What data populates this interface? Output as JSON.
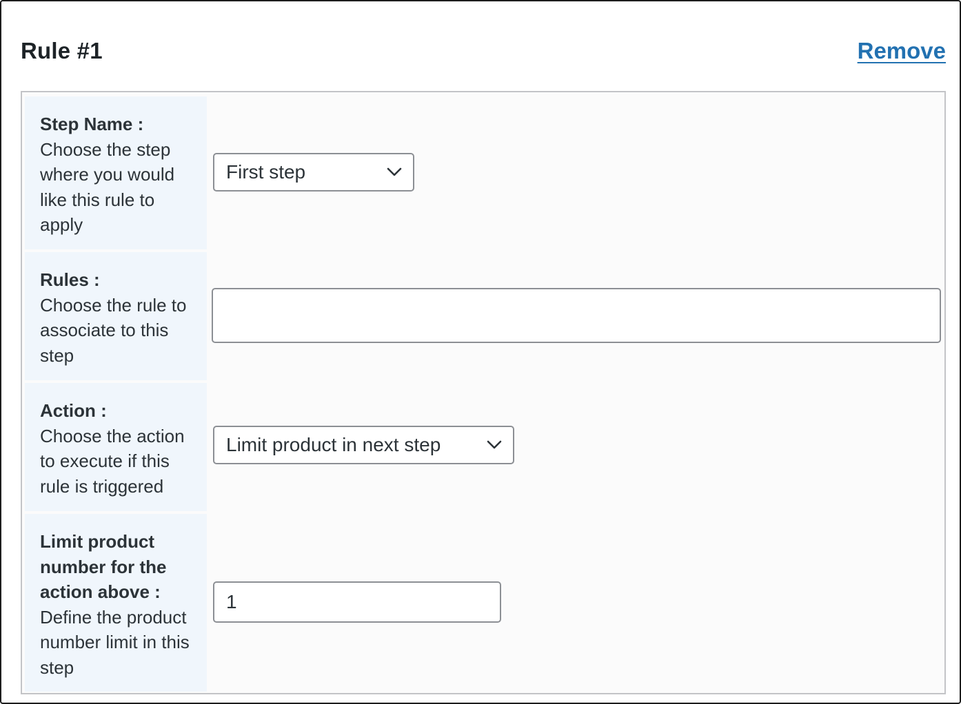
{
  "header": {
    "title": "Rule #1",
    "remove_label": "Remove"
  },
  "rows": [
    {
      "label": "Step Name :",
      "description": "Choose the step where you would like this rule to apply",
      "control": "select",
      "value": "First step"
    },
    {
      "label": "Rules :",
      "description": "Choose the rule to associate to this step",
      "control": "text",
      "value": ""
    },
    {
      "label": "Action :",
      "description": "Choose the action to execute if this rule is triggered",
      "control": "select",
      "value": "Limit product in next step"
    },
    {
      "label": "Limit product number for the action above :",
      "description": "Define the product number limit in this step",
      "control": "number",
      "value": "1"
    }
  ],
  "icons": {
    "select_arrow": "chevron-down-icon"
  },
  "colors": {
    "link": "#2271b1",
    "label_background": "#f0f6fc",
    "border": "#8c8f94"
  }
}
